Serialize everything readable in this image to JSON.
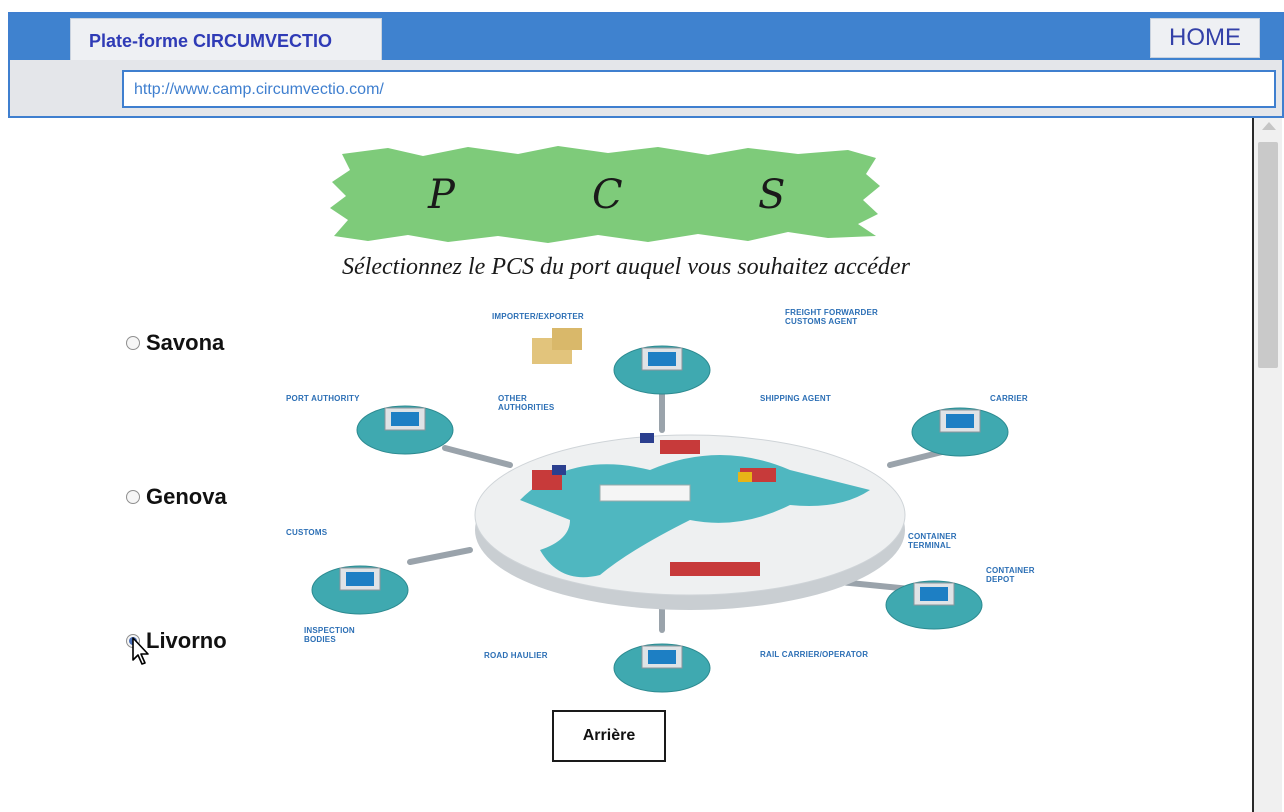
{
  "browser": {
    "tab_title": "Plate-forme  CIRCUMVECTIO",
    "home_label": "HOME",
    "url": "http://www.camp.circumvectio.com/"
  },
  "logo": {
    "letters": [
      "P",
      "C",
      "S"
    ],
    "color": "#7ecb7a"
  },
  "page": {
    "subtitle": "Sélectionnez le PCS du port auquel vous souhaitez accéder"
  },
  "ports": [
    {
      "label": "Savona",
      "selected": false
    },
    {
      "label": "Genova",
      "selected": false
    },
    {
      "label": "Livorno",
      "selected": true
    }
  ],
  "diagram": {
    "labels": {
      "importer": "IMPORTER/EXPORTER",
      "freight1": "FREIGHT FORWARDER",
      "freight2": "CUSTOMS AGENT",
      "port_authority": "PORT AUTHORITY",
      "other1": "OTHER",
      "other2": "AUTHORITIES",
      "shipping_agent": "SHIPPING AGENT",
      "carrier": "CARRIER",
      "customs": "CUSTOMS",
      "container_terminal1": "CONTAINER",
      "container_terminal2": "TERMINAL",
      "container_depot1": "CONTAINER",
      "container_depot2": "DEPOT",
      "inspection1": "INSPECTION",
      "inspection2": "BODIES",
      "road_haulier": "ROAD HAULIER",
      "rail_carrier": "RAIL CARRIER/OPERATOR"
    }
  },
  "actions": {
    "back_label": "Arrière"
  },
  "colors": {
    "chrome_blue": "#3f82cf",
    "tab_text": "#2f3bb6",
    "teal": "#3fa9b0",
    "diagram_label": "#2c6fb5"
  }
}
